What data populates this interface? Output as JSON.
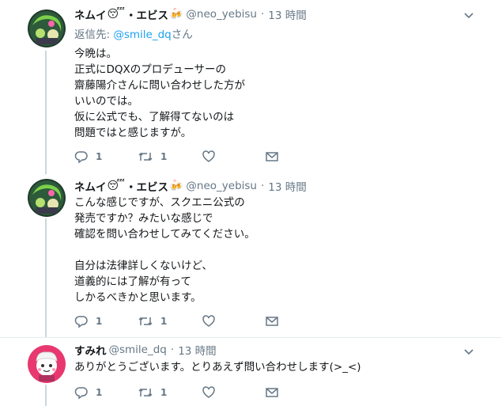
{
  "colors": {
    "link": "#1da1f2",
    "secondary_text": "#657786",
    "thread_line": "#ccd6dd",
    "divider": "#e6ecf0"
  },
  "tweets": [
    {
      "display_name": "ネムイ",
      "name_suffix": "・エビス",
      "emoji_1": "😴",
      "emoji_2": "🍻",
      "handle": "@neo_yebisu",
      "time": "13 時間",
      "reply_prefix": "返信先: ",
      "reply_handle": "@smile_dq",
      "reply_suffix": "さん",
      "lines": [
        "今晩は。",
        "正式にDQXのプロデューサーの",
        "齋藤陽介さんに問い合わせした方が",
        "いいのでは。",
        "仮に公式でも、了解得てないのは",
        "問題ではと感じますが。"
      ],
      "reply_count": "1",
      "retweet_count": "1",
      "icons": [
        "reply-icon",
        "retweet-icon",
        "like-icon",
        "dm-icon"
      ]
    },
    {
      "display_name": "ネムイ",
      "name_suffix": "・エビス",
      "emoji_1": "😴",
      "emoji_2": "🍻",
      "handle": "@neo_yebisu",
      "time": "13 時間",
      "lines": [
        "こんな感じですが、スクエニ公式の",
        "発売ですか？みたいな感じで",
        "確認を問い合わせしてみてください。",
        "",
        "自分は法律詳しくないけど、",
        "道義的には了解が有って",
        "しかるべきかと思います。"
      ],
      "reply_count": "1",
      "retweet_count": "1"
    },
    {
      "display_name": "すみれ",
      "handle": "@smile_dq",
      "time": "13 時間",
      "lines": [
        "ありがとうございます。とりあえず問い合わせします(>_<)"
      ],
      "reply_count": "1",
      "retweet_count": "1"
    }
  ]
}
